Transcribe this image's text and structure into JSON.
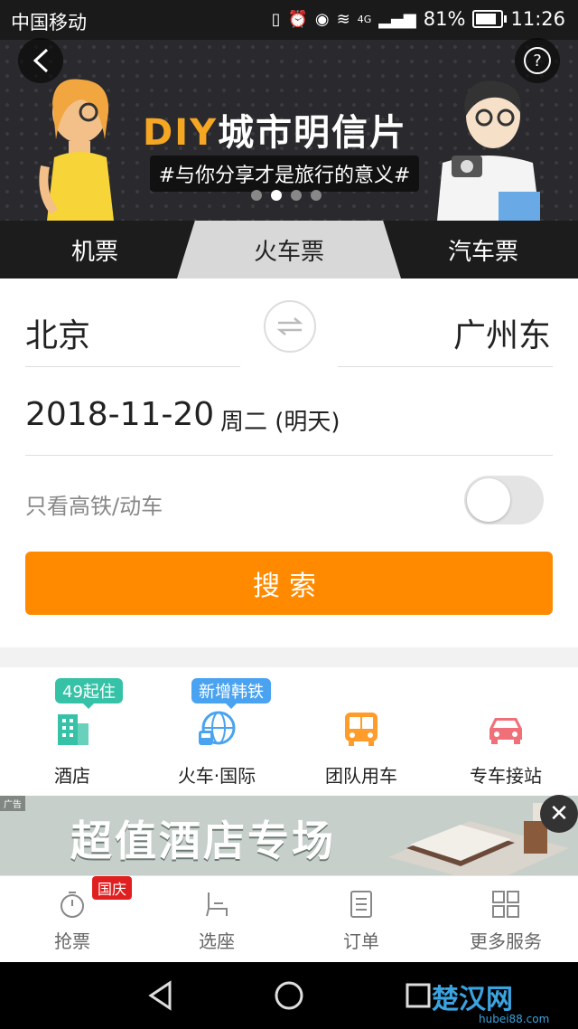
{
  "status_bar": {
    "carrier": "中国移动",
    "signal_badge": "4G",
    "battery": "81%",
    "time": "11:26"
  },
  "banner": {
    "title_diy": "DIY",
    "title_rest": "城市明信片",
    "subtitle": "#与你分享才是旅行的意义#",
    "dots": 4,
    "active_dot": 2
  },
  "tabs": [
    {
      "label": "机票"
    },
    {
      "label": "火车票"
    },
    {
      "label": "汽车票"
    }
  ],
  "form": {
    "from_city": "北京",
    "to_city": "广州东",
    "date": "2018-11-20",
    "weekday": "周二 (明天)",
    "hsr_only_label": "只看高铁/动车",
    "hsr_only": false,
    "search_label": "搜索"
  },
  "services": [
    {
      "label": "酒店",
      "badge": "49起住",
      "badge_color": "#35c2a6",
      "icon": "hotel-icon",
      "color": "#35c2a6"
    },
    {
      "label": "火车·国际",
      "badge": "新增韩铁",
      "badge_color": "#4aa3f0",
      "icon": "globe-train-icon",
      "color": "#4aa3f0"
    },
    {
      "label": "团队用车",
      "badge": "",
      "icon": "bus-icon",
      "color": "#ff9c2a"
    },
    {
      "label": "专车接站",
      "badge": "",
      "icon": "car-icon",
      "color": "#f0707a"
    }
  ],
  "ad": {
    "tag": "广告",
    "text": "超值酒店专场"
  },
  "bottom_nav": [
    {
      "label": "抢票",
      "icon": "stopwatch-icon",
      "badge": "国庆"
    },
    {
      "label": "选座",
      "icon": "seat-icon",
      "badge": ""
    },
    {
      "label": "订单",
      "icon": "list-icon",
      "badge": ""
    },
    {
      "label": "更多服务",
      "icon": "grid-icon",
      "badge": ""
    }
  ],
  "watermark": {
    "text": "楚汉网",
    "sub": "hubei88.com"
  },
  "colors": {
    "accent": "#ff8a00",
    "tab_active_bg": "#d8d8d8",
    "dark": "#1c1c1c"
  }
}
